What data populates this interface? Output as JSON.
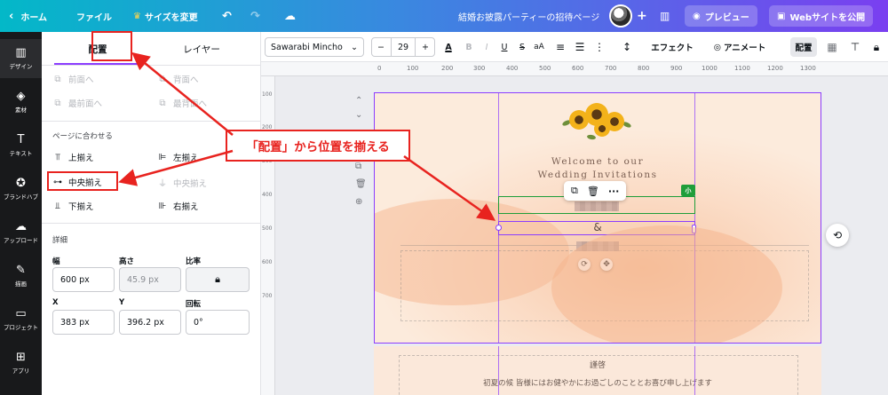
{
  "topbar": {
    "back_home": "ホーム",
    "file": "ファイル",
    "resize": "サイズを変更",
    "doc_title": "結婚お披露パーティーの招待ページ",
    "preview": "プレビュー",
    "publish": "Webサイトを公開",
    "add": "+"
  },
  "rail": [
    {
      "icon": "layout-icon",
      "glyph": "▥",
      "label": "デザイン"
    },
    {
      "icon": "elements-icon",
      "glyph": "◈",
      "label": "素材"
    },
    {
      "icon": "text-icon",
      "glyph": "T",
      "label": "テキスト"
    },
    {
      "icon": "brand-icon",
      "glyph": "✪",
      "label": "ブランドハブ"
    },
    {
      "icon": "upload-icon",
      "glyph": "☁",
      "label": "アップロード"
    },
    {
      "icon": "draw-icon",
      "glyph": "✎",
      "label": "描画"
    },
    {
      "icon": "folder-icon",
      "glyph": "▭",
      "label": "プロジェクト"
    },
    {
      "icon": "apps-icon",
      "glyph": "⊞",
      "label": "アプリ"
    }
  ],
  "panel": {
    "tab_arrange": "配置",
    "tab_layers": "レイヤー",
    "order": {
      "forward": "前面へ",
      "backward": "背面へ",
      "to_front": "最前面へ",
      "to_back": "最背面へ"
    },
    "align_section": "ページに合わせる",
    "align": {
      "top": "上揃え",
      "left": "左揃え",
      "middle": "中央揃え",
      "center": "中央揃え",
      "bottom": "下揃え",
      "right": "右揃え"
    },
    "details_section": "詳細",
    "width_label": "幅",
    "width_value": "600 px",
    "height_label": "高さ",
    "height_value": "45.9 px",
    "ratio_label": "比率",
    "x_label": "X",
    "x_value": "383 px",
    "y_label": "Y",
    "y_value": "396.2 px",
    "rotate_label": "回転",
    "rotate_value": "0°"
  },
  "toolbar": {
    "font_family": "Sawarabi Mincho",
    "font_size": "29",
    "minus": "−",
    "plus": "+",
    "color_letter": "A",
    "bold": "B",
    "italic": "I",
    "underline": "U",
    "strike": "S",
    "caps": "aA",
    "effects": "エフェクト",
    "animate": "アニメート",
    "arrange": "配置"
  },
  "ruler": [
    "0",
    "100",
    "200",
    "300",
    "400",
    "500",
    "600",
    "700",
    "800",
    "900",
    "1000",
    "1100",
    "1200",
    "1300"
  ],
  "ruler_v": [
    "100",
    "200",
    "300",
    "400",
    "500",
    "600",
    "700"
  ],
  "canvas": {
    "welcome_line1": "Welcome to our",
    "welcome_line2": "Wedding Invitations",
    "ampersand": "&",
    "size_badge": "小",
    "page2_heading": "謹啓",
    "page2_text": "初夏の候 皆様にはお健やかにお過ごしのこととお喜び申し上げます"
  },
  "annotation": {
    "callout_text": "「配置」から位置を揃える"
  },
  "colors": {
    "accent": "#8b3dff",
    "callout": "#e8231f",
    "rail_bg": "#18191b",
    "text_box_green": "#1f9e3a"
  }
}
